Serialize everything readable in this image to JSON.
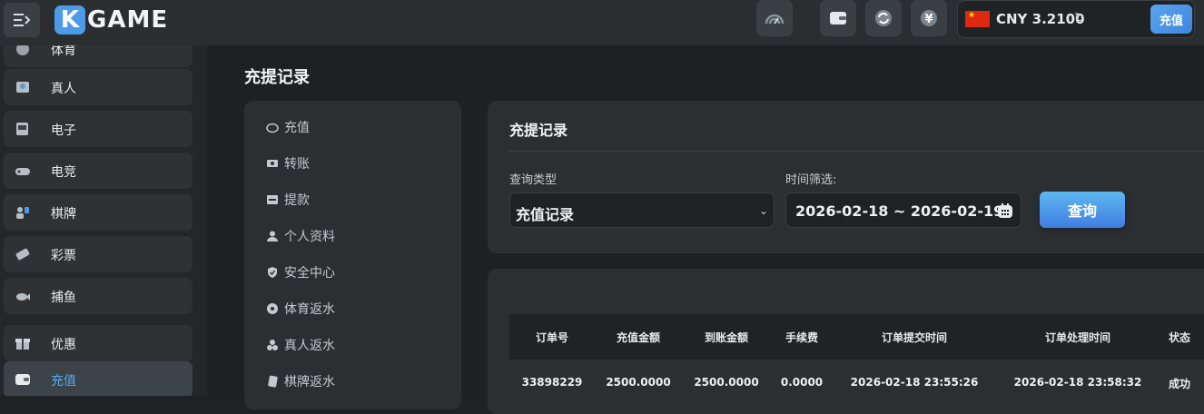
{
  "header": {
    "logo_letter": "K",
    "logo_text": "GAME",
    "wallet_amount": "CNY 3.2100",
    "recharge_label": "充值",
    "icons": [
      "menu-icon",
      "signal-icon",
      "wallet-icon",
      "refresh-icon",
      "yuan-icon"
    ]
  },
  "sidebar": {
    "items": [
      {
        "label": "体育",
        "icon": "sports-icon"
      },
      {
        "label": "真人",
        "icon": "live-dealer-icon"
      },
      {
        "label": "电子",
        "icon": "slot-machine-icon"
      },
      {
        "label": "电竞",
        "icon": "gamepad-icon"
      },
      {
        "label": "棋牌",
        "icon": "cards-icon"
      },
      {
        "label": "彩票",
        "icon": "lottery-icon"
      },
      {
        "label": "捕鱼",
        "icon": "fish-icon"
      },
      {
        "label": "优惠",
        "icon": "gift-icon"
      },
      {
        "label": "充值",
        "icon": "deposit-icon",
        "active": true
      }
    ]
  },
  "page": {
    "title": "充提记录"
  },
  "menu": {
    "items": [
      {
        "label": "充值",
        "icon": "piggy-icon"
      },
      {
        "label": "转账",
        "icon": "transfer-icon"
      },
      {
        "label": "提款",
        "icon": "withdraw-icon"
      },
      {
        "label": "个人资料",
        "icon": "user-icon"
      },
      {
        "label": "安全中心",
        "icon": "shield-icon"
      },
      {
        "label": "体育返水",
        "icon": "soccer-icon"
      },
      {
        "label": "真人返水",
        "icon": "chips-icon"
      },
      {
        "label": "棋牌返水",
        "icon": "poker-icon"
      }
    ]
  },
  "filter": {
    "title": "充提记录",
    "type_label": "查询类型",
    "type_value": "充值记录",
    "time_label": "时间筛选:",
    "date_range": "2026-02-18 ~ 2026-02-19",
    "query_label": "查询"
  },
  "table": {
    "headers": [
      "订单号",
      "充值金额",
      "到账金额",
      "手续费",
      "订单提交时间",
      "订单处理时间",
      "状态"
    ],
    "rows": [
      [
        "33898229",
        "2500.0000",
        "2500.0000",
        "0.0000",
        "2026-02-18 23:55:26",
        "2026-02-18 23:58:32",
        "成功"
      ]
    ]
  },
  "colors": {
    "accent": "#4c9be8",
    "active_text": "#5aa8f0",
    "flag_red": "#de2910",
    "flag_star": "#ffde00"
  }
}
